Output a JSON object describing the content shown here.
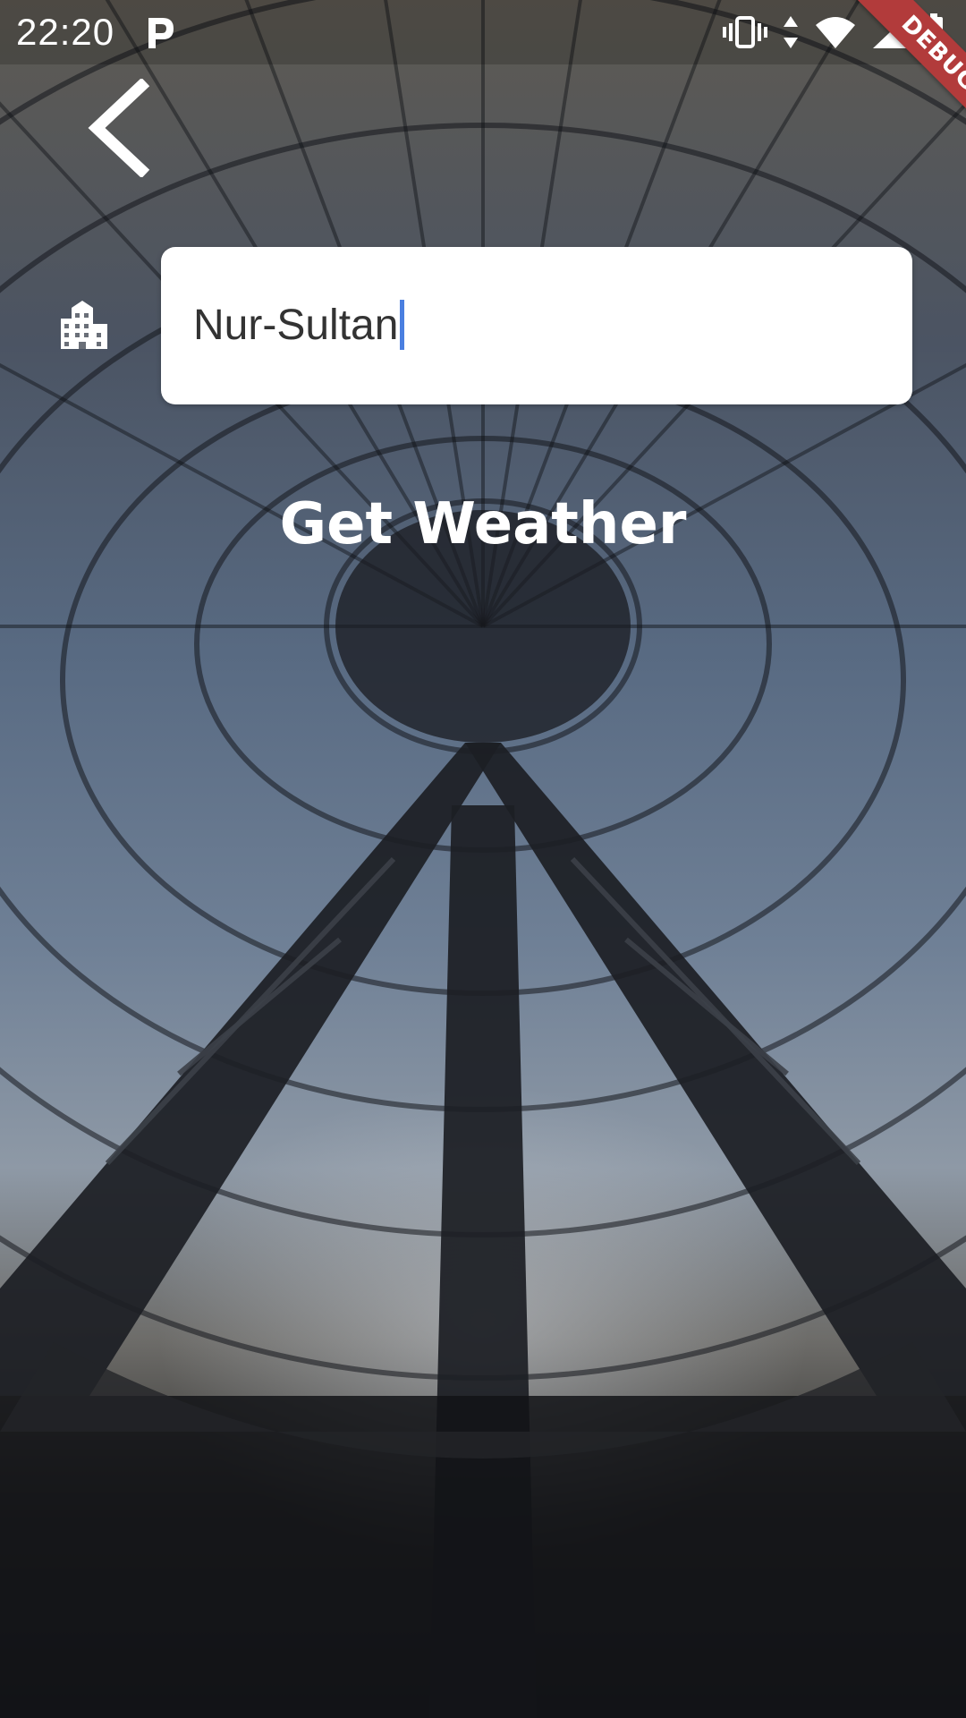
{
  "status_bar": {
    "time": "22:20",
    "app_icon": "parking-p-icon",
    "icons": [
      "vibrate-icon",
      "data-arrows-icon",
      "wifi-icon",
      "signal-icon",
      "battery-charging-icon"
    ],
    "debug_label": "DEBUG"
  },
  "toolbar": {
    "back_icon": "chevron-left-icon"
  },
  "search": {
    "city_icon": "city-buildings-icon",
    "value": "Nur-Sultan"
  },
  "action": {
    "label": "Get Weather"
  },
  "colors": {
    "text_on_image": "#ffffff",
    "input_background": "#ffffff",
    "input_text": "#333333",
    "cursor": "#4a7fe0",
    "debug_ribbon": "#b23b3b"
  }
}
